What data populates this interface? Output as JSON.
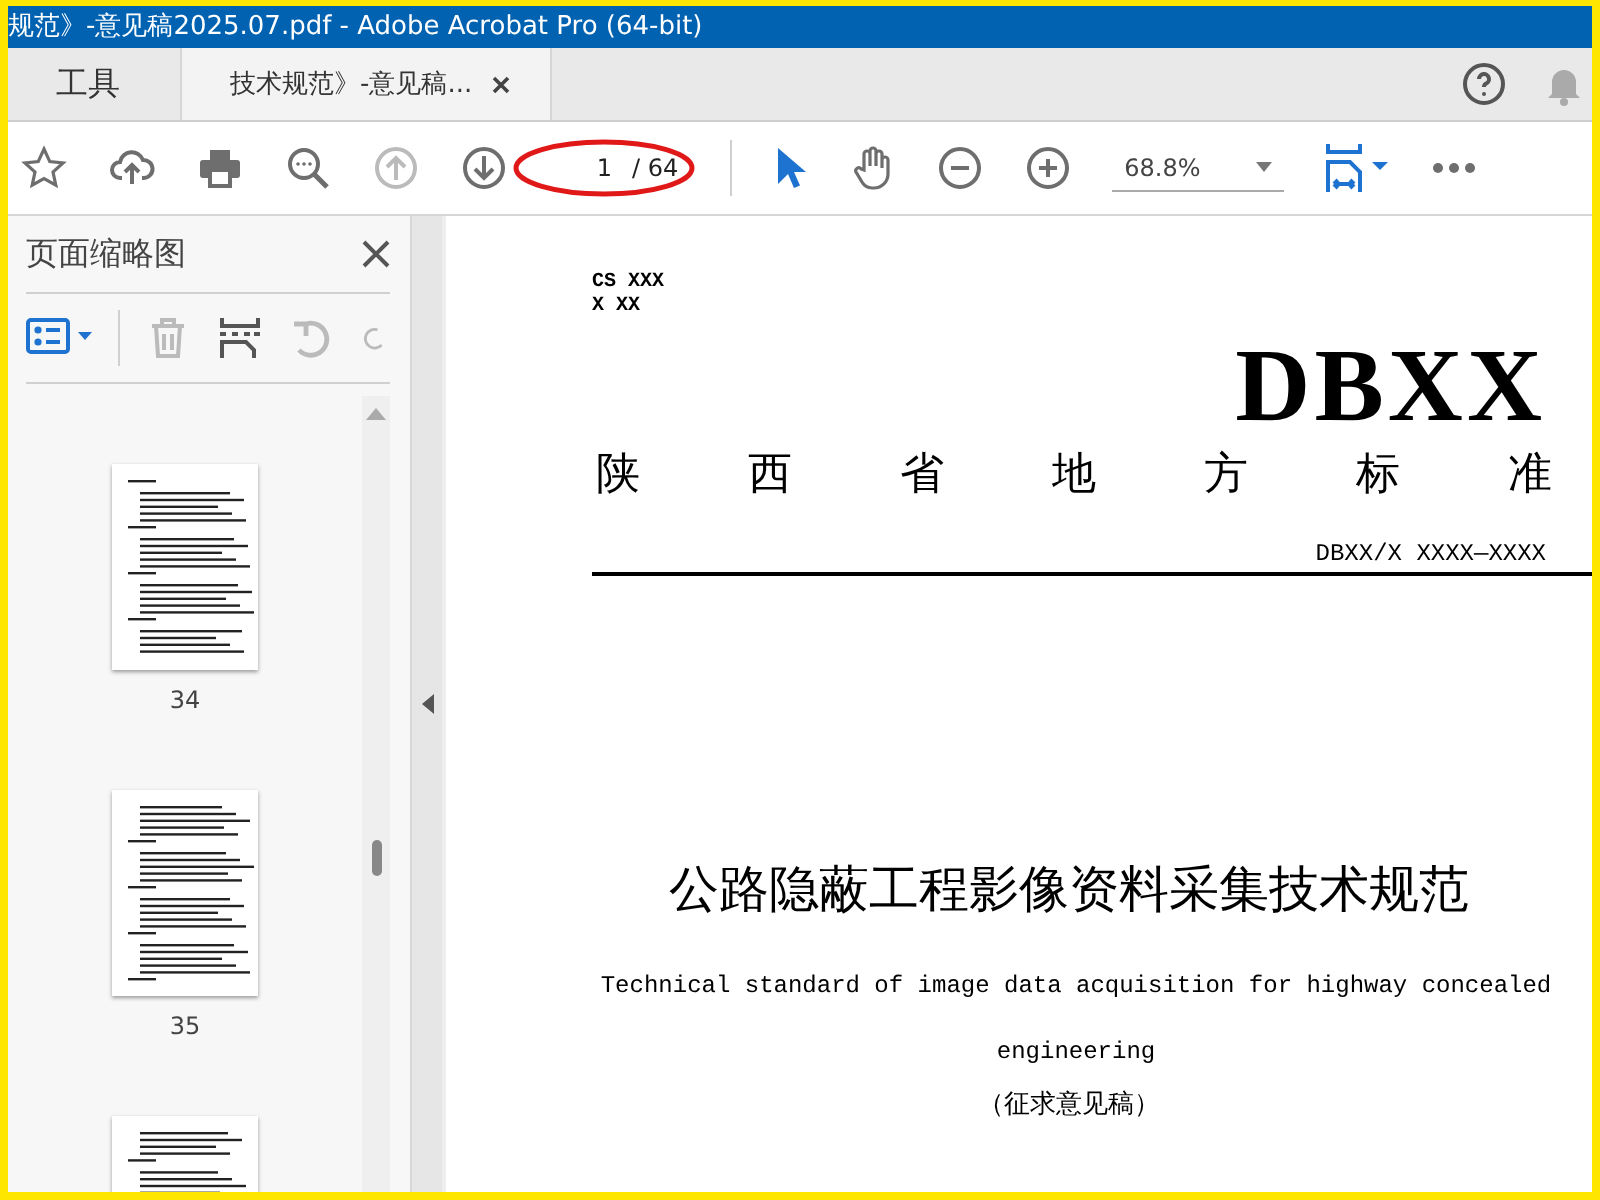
{
  "window": {
    "title": "规范》-意见稿2025.07.pdf - Adobe Acrobat Pro (64-bit)"
  },
  "tabs": [
    {
      "label": "工具",
      "selected": false,
      "closable": false
    },
    {
      "label": "技术规范》-意见稿...",
      "selected": true,
      "closable": true
    }
  ],
  "toolbar": {
    "page": "1",
    "page_count": "/ 64",
    "zoom": "68.8%"
  },
  "panel": {
    "title": "页面缩略图",
    "thumbnails": [
      {
        "label": "34"
      },
      {
        "label": "35"
      }
    ],
    "next_thumbnail_partly_shown": true
  },
  "document": {
    "classification": [
      "CS XXX",
      "X XX"
    ],
    "logo": "DBXX",
    "standard_type": "陕 西 省 地 方 标 准",
    "code": "DBXX/X XXXX—XXXX",
    "title": "公路隐蔽工程影像资料采集技术规范",
    "subtitle_en": "Technical standard of image data acquisition for highway concealed engineering",
    "status": "（征求意见稿）"
  }
}
